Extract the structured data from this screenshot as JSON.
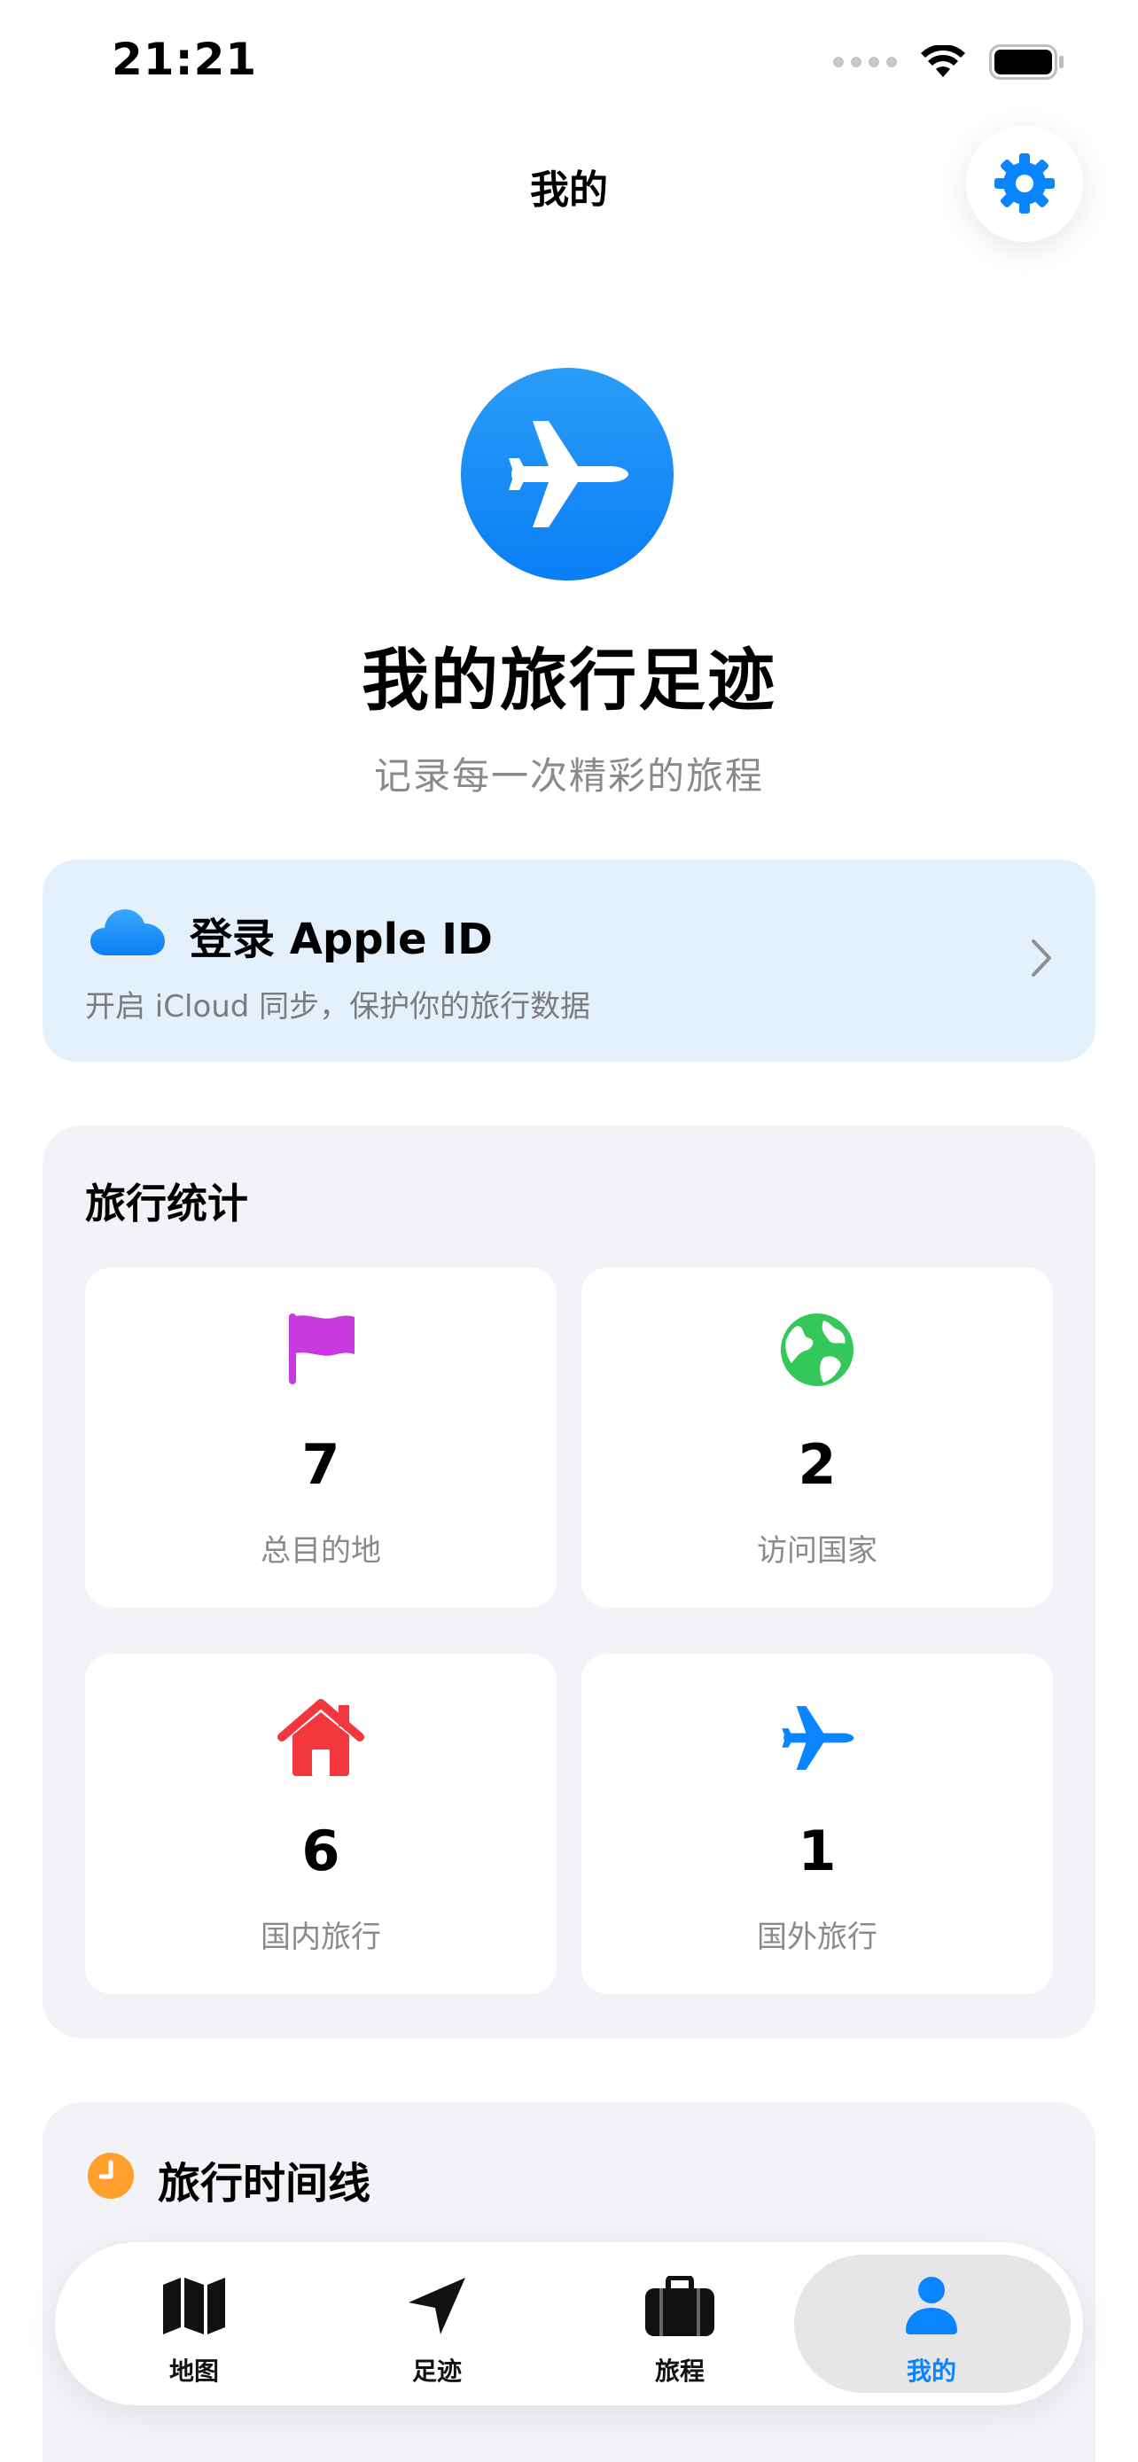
{
  "status_bar": {
    "time": "21:21"
  },
  "nav": {
    "title": "我的"
  },
  "hero": {
    "title": "我的旅行足迹",
    "subtitle": "记录每一次精彩的旅程"
  },
  "login": {
    "title": "登录 Apple ID",
    "subtitle": "开启 iCloud 同步，保护你的旅行数据"
  },
  "stats": {
    "title": "旅行统计",
    "items": [
      {
        "icon": "flag-icon",
        "value": "7",
        "label": "总目的地",
        "color": "#c73ae0"
      },
      {
        "icon": "globe-icon",
        "value": "2",
        "label": "访问国家",
        "color": "#34c759"
      },
      {
        "icon": "house-icon",
        "value": "6",
        "label": "国内旅行",
        "color": "#f2373f"
      },
      {
        "icon": "airplane-icon",
        "value": "1",
        "label": "国外旅行",
        "color": "#0a84ff"
      }
    ]
  },
  "timeline": {
    "title": "旅行时间线"
  },
  "tabbar": {
    "items": [
      {
        "label": "地图",
        "icon": "map-icon"
      },
      {
        "label": "足迹",
        "icon": "location-arrow-icon"
      },
      {
        "label": "旅程",
        "icon": "suitcase-icon"
      },
      {
        "label": "我的",
        "icon": "person-icon"
      }
    ],
    "selected": "我的"
  },
  "colors": {
    "accent": "#0a84ff",
    "card_bg": "#f2f2f7",
    "login_bg": "#e4f0fc",
    "timeline_clock": "#ff9f2e"
  }
}
